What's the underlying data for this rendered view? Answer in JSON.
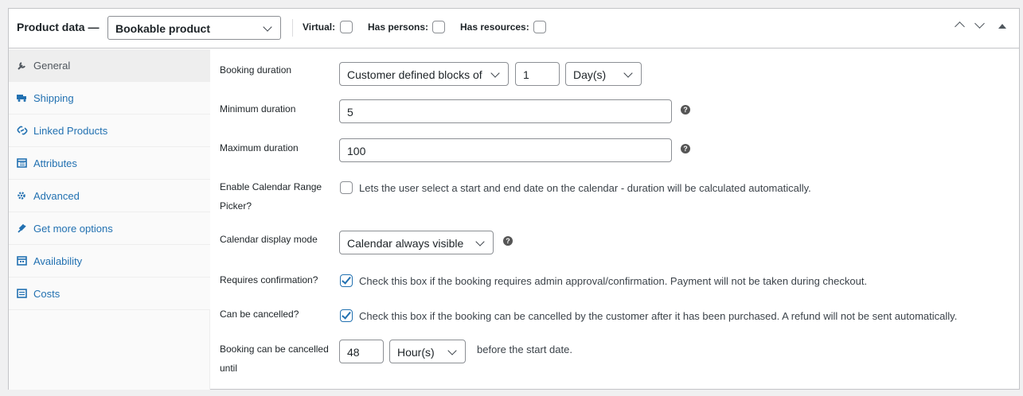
{
  "header": {
    "title": "Product data —",
    "product_type": "Bookable product",
    "options": [
      "Virtual:",
      "Has persons:",
      "Has resources:"
    ]
  },
  "tabs": [
    {
      "label": "General",
      "icon": "wrench-icon",
      "active": true
    },
    {
      "label": "Shipping",
      "icon": "truck-icon"
    },
    {
      "label": "Linked Products",
      "icon": "link-icon"
    },
    {
      "label": "Attributes",
      "icon": "table-icon"
    },
    {
      "label": "Advanced",
      "icon": "gear-icon"
    },
    {
      "label": "Get more options",
      "icon": "plugin-icon"
    },
    {
      "label": "Availability",
      "icon": "calendar-icon"
    },
    {
      "label": "Costs",
      "icon": "list-icon"
    }
  ],
  "fields": {
    "booking_duration": {
      "label": "Booking duration",
      "type_value": "Customer defined blocks of",
      "amount": "1",
      "unit": "Day(s)"
    },
    "min_duration": {
      "label": "Minimum duration",
      "value": "5"
    },
    "max_duration": {
      "label": "Maximum duration",
      "value": "100"
    },
    "range_picker": {
      "label_line1": "Enable Calendar Range",
      "label_line2": "Picker?",
      "description": "Lets the user select a start and end date on the calendar - duration will be calculated automatically.",
      "checked": false
    },
    "calendar_mode": {
      "label": "Calendar display mode",
      "value": "Calendar always visible"
    },
    "requires_confirmation": {
      "label": "Requires confirmation?",
      "description": "Check this box if the booking requires admin approval/confirmation. Payment will not be taken during checkout.",
      "checked": true
    },
    "can_cancel": {
      "label": "Can be cancelled?",
      "description": "Check this box if the booking can be cancelled by the customer after it has been purchased. A refund will not be sent automatically.",
      "checked": true
    },
    "cancel_until": {
      "label_line1": "Booking can be cancelled",
      "label_line2": "until",
      "amount": "48",
      "unit": "Hour(s)",
      "suffix": "before the start date."
    }
  },
  "colors": {
    "link": "#2271b1",
    "border": "#8c8f94",
    "background": "#f0f0f1"
  }
}
